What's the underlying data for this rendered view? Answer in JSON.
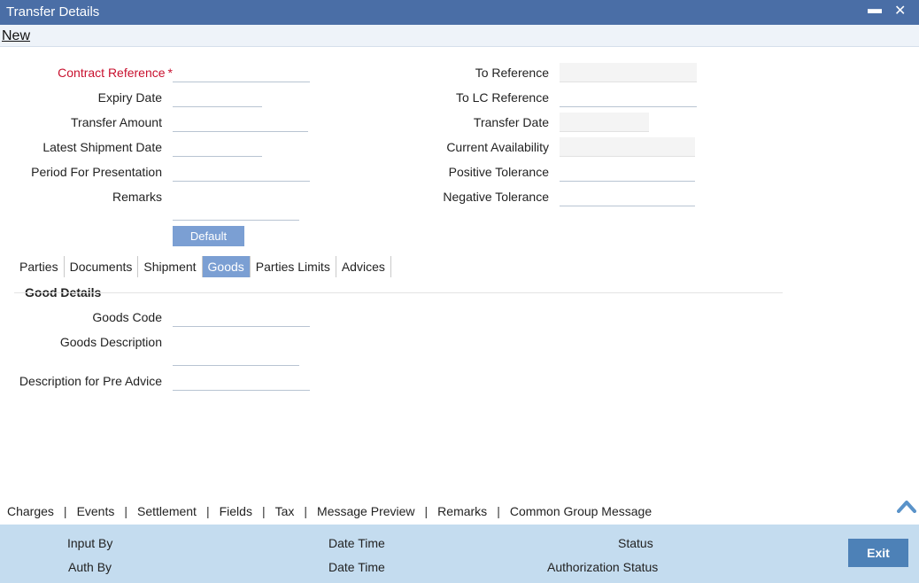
{
  "window": {
    "title": "Transfer Details",
    "minimize_glyph": "▬",
    "close_glyph": "✕"
  },
  "toolbar": {
    "new_label": "New"
  },
  "form": {
    "contract_reference": {
      "label": "Contract Reference",
      "required_mark": "*",
      "value": ""
    },
    "expiry_date": {
      "label": "Expiry Date",
      "value": ""
    },
    "transfer_amount": {
      "label": "Transfer Amount",
      "value": ""
    },
    "latest_shipment_date": {
      "label": "Latest Shipment Date",
      "value": ""
    },
    "period_for_presentation": {
      "label": "Period For Presentation",
      "value": ""
    },
    "remarks": {
      "label": "Remarks",
      "value": ""
    },
    "to_reference": {
      "label": "To Reference",
      "value": ""
    },
    "to_lc_reference": {
      "label": "To LC Reference",
      "value": ""
    },
    "transfer_date": {
      "label": "Transfer Date",
      "value": ""
    },
    "current_availability": {
      "label": "Current Availability",
      "value": ""
    },
    "positive_tolerance": {
      "label": "Positive Tolerance",
      "value": ""
    },
    "negative_tolerance": {
      "label": "Negative Tolerance",
      "value": ""
    },
    "default_button": "Default"
  },
  "tabs": [
    {
      "label": "Parties",
      "active": false
    },
    {
      "label": "Documents",
      "active": false
    },
    {
      "label": "Shipment",
      "active": false
    },
    {
      "label": "Goods",
      "active": true
    },
    {
      "label": "Parties Limits",
      "active": false
    },
    {
      "label": "Advices",
      "active": false
    }
  ],
  "goods": {
    "section_title": "Good Details",
    "goods_code": {
      "label": "Goods Code",
      "value": ""
    },
    "goods_description": {
      "label": "Goods Description",
      "value": ""
    },
    "pre_advice_description": {
      "label": "Description for Pre Advice",
      "value": ""
    }
  },
  "bottom_links": [
    "Charges",
    "Events",
    "Settlement",
    "Fields",
    "Tax",
    "Message Preview",
    "Remarks",
    "Common Group Message"
  ],
  "bottom_link_separator": "|",
  "footer": {
    "input_by": "Input By",
    "date_time_1": "Date Time",
    "status": "Status",
    "auth_by": "Auth By",
    "date_time_2": "Date Time",
    "authorization_status": "Authorization Status",
    "exit_label": "Exit"
  },
  "colors": {
    "titlebar": "#4a6ea6",
    "accent": "#7b9fd3",
    "required": "#c8102e",
    "footer": "#c4dcef",
    "exit_button": "#4d81b7"
  },
  "icons": {
    "collapse": "chevron-up-icon",
    "minimize": "minimize-icon",
    "close": "close-icon"
  }
}
